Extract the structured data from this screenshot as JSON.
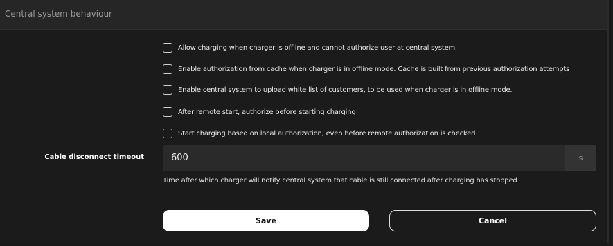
{
  "section": {
    "title": "Central system behaviour"
  },
  "options": [
    {
      "label": "Allow charging when charger is offline and cannot authorize user at central system",
      "checked": false
    },
    {
      "label": "Enable authorization from cache when charger is in offline mode. Cache is built from previous authorization attempts",
      "checked": false
    },
    {
      "label": "Enable central system to upload white list of customers, to be used when charger is in offline mode.",
      "checked": false
    },
    {
      "label": "After remote start, authorize before starting charging",
      "checked": false
    },
    {
      "label": "Start charging based on local authorization, even before remote authorization is checked",
      "checked": false
    }
  ],
  "cable_timeout": {
    "label": "Cable disconnect timeout",
    "value": "600",
    "unit": "s",
    "help": "Time after which charger will notify central system that cable is still connected after charging has stopped"
  },
  "actions": {
    "save_label": "Save",
    "cancel_label": "Cancel"
  }
}
